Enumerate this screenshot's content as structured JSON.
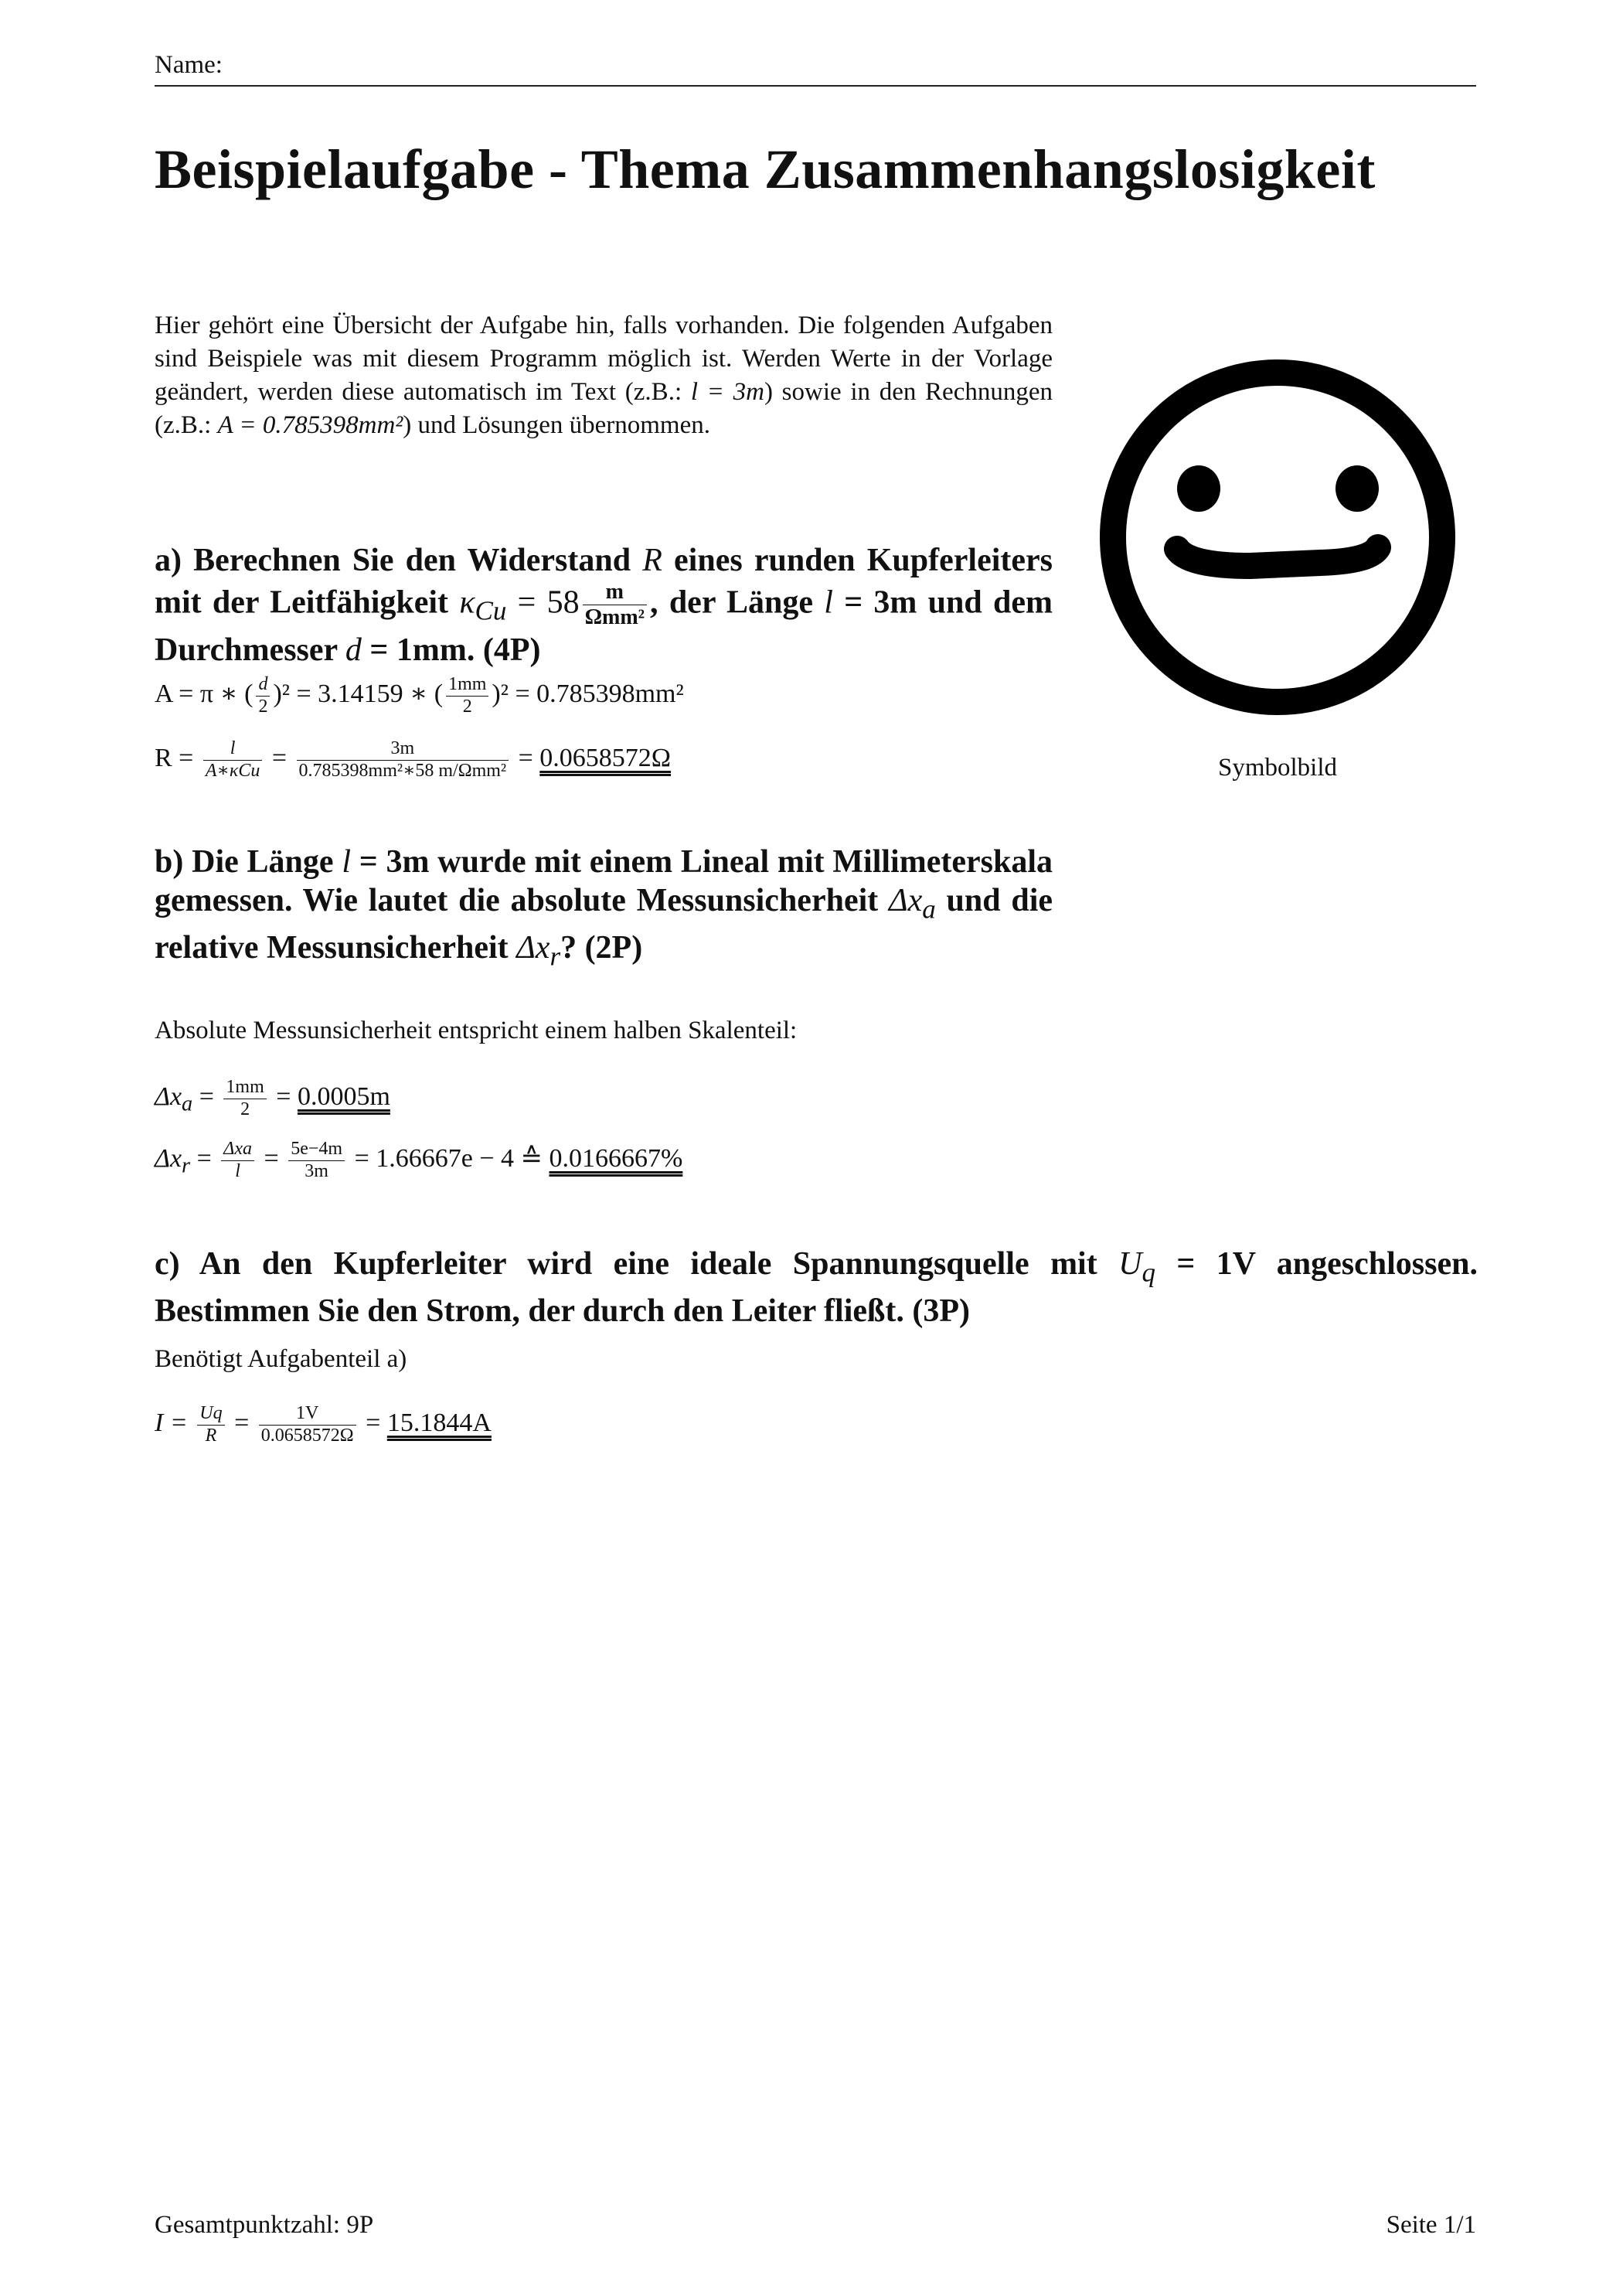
{
  "header": {
    "name_label": "Name:"
  },
  "title": "Beispielaufgabe - Thema Zusammenhangslosigkeit",
  "intro": {
    "text1": "Hier gehört eine Übersicht der Aufgabe hin, falls vorhanden. Die folgenden Aufgaben sind Beispiele was mit diesem Programm möglich ist. Werden Werte in der Vorlage geändert, werden diese automatisch im Text (z.B.: ",
    "l_val": "l = 3m",
    "text2": ") sowie in den Rechnungen (z.B.: ",
    "a_val": "A = 0.785398mm²",
    "text3": ") und Lösungen übernommen."
  },
  "figure": {
    "caption": "Symbolbild",
    "icon": "smiley-face"
  },
  "task_a": {
    "q1": "a) Berechnen Sie den Widerstand ",
    "q_R": "R",
    "q2": " eines runden Kupferleiters mit der Leitfähigkeit ",
    "q_kappa": "κ",
    "q_kappa_sub": "Cu",
    "q3": " = 58",
    "q_unit_num": "m",
    "q_unit_den": "Ωmm²",
    "q4": ", der Länge ",
    "q_l": "l",
    "q5": " = 3m und dem Durchmesser ",
    "q_d": "d",
    "q6": " = 1mm. (4P)",
    "eq1_lhs": "A = π ∗ (",
    "eq1_fd_num": "d",
    "eq1_fd_den": "2",
    "eq1_mid": ")² = 3.14159 ∗ (",
    "eq1_f2_num": "1mm",
    "eq1_f2_den": "2",
    "eq1_rhs": ")² = 0.785398mm²",
    "eq2_lhs": "R =",
    "eq2_f1_num": "l",
    "eq2_f1_den": "A∗κCu",
    "eq2_eq": "=",
    "eq2_f2_num": "3m",
    "eq2_f2_den": "0.785398mm²∗58 m/Ωmm²",
    "eq2_eq2": "=",
    "eq2_result": "0.0658572Ω"
  },
  "task_b": {
    "q1": "b) Die Länge ",
    "q_l": "l",
    "q2": " = 3m wurde mit einem Lineal mit Millimeterskala gemessen. Wie lautet die absolute Messunsicherheit ",
    "q_dxa": "Δx",
    "q_dxa_sub": "a",
    "q3": " und die relative Messunsicherheit ",
    "q_dxr": "Δx",
    "q_dxr_sub": "r",
    "q4": "? (2P)",
    "note": "Absolute Messunsicherheit entspricht einem halben Skalenteil:",
    "eq1_lhs": "Δx",
    "eq1_lhs_sub": "a",
    "eq1_eq": " =",
    "eq1_f_num": "1mm",
    "eq1_f_den": "2",
    "eq1_eq2": "=",
    "eq1_result": "0.0005m",
    "eq2_lhs": "Δx",
    "eq2_lhs_sub": "r",
    "eq2_eq": " =",
    "eq2_f1_num": "Δxa",
    "eq2_f1_den": "l",
    "eq2_eq2": "=",
    "eq2_f2_num": "5e−4m",
    "eq2_f2_den": "3m",
    "eq2_mid": "= 1.66667e − 4 ≙",
    "eq2_result": "0.0166667%"
  },
  "task_c": {
    "q1": "c) An den Kupferleiter wird eine ideale Spannungsquelle mit ",
    "q_U": "U",
    "q_U_sub": "q",
    "q2": " = 1V angeschlossen. Bestimmen Sie den Strom, der durch den Leiter fließt. (3P)",
    "note": "Benötigt Aufgabenteil a)",
    "eq_lhs": "I =",
    "eq_f1_num": "Uq",
    "eq_f1_den": "R",
    "eq_eq": "=",
    "eq_f2_num": "1V",
    "eq_f2_den": "0.0658572Ω",
    "eq_eq2": "=",
    "eq_result": "15.1844A"
  },
  "footer": {
    "total": "Gesamtpunktzahl: 9P",
    "page": "Seite 1/1"
  }
}
